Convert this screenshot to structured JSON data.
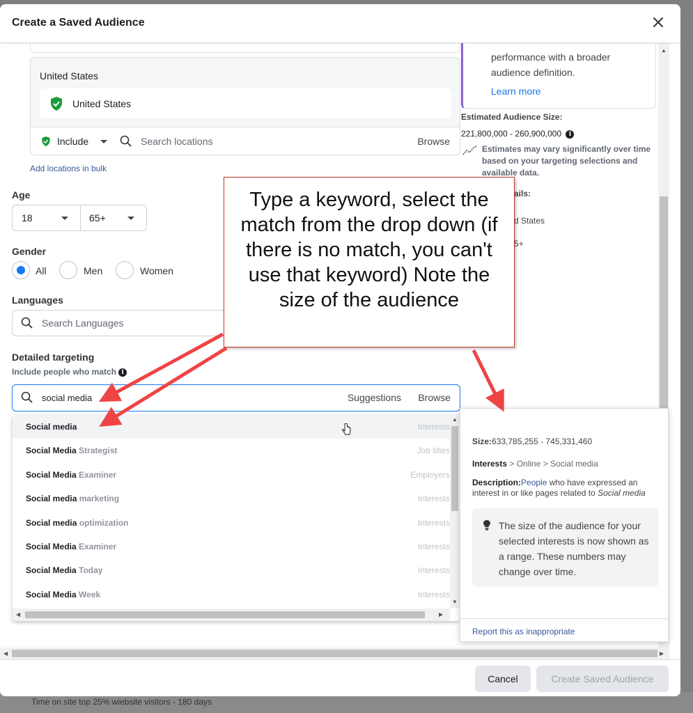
{
  "background": {
    "text": "Time on site top 25% wiebsite visitors - 180 days"
  },
  "modal": {
    "title": "Create a Saved Audience"
  },
  "locations": {
    "country": "United States",
    "chip": "United States",
    "include_label": "Include",
    "search_placeholder": "Search locations",
    "browse": "Browse",
    "bulk": "Add locations in bulk"
  },
  "age": {
    "label": "Age",
    "min": "18",
    "max": "65+"
  },
  "gender": {
    "label": "Gender",
    "options": [
      "All",
      "Men",
      "Women"
    ],
    "selected": "All"
  },
  "languages": {
    "label": "Languages",
    "placeholder": "Search Languages"
  },
  "detailed": {
    "label": "Detailed targeting",
    "sublabel": "Include people who match",
    "value": "social media",
    "suggestions": "Suggestions",
    "browse": "Browse",
    "results": [
      {
        "match": "Social media",
        "rest": "",
        "category": "Interests"
      },
      {
        "match": "Social Media",
        "rest": " Strategist",
        "category": "Job titles"
      },
      {
        "match": "Social Media",
        "rest": " Examiner",
        "category": "Employers"
      },
      {
        "match": "Social media",
        "rest": " marketing",
        "category": "Interests"
      },
      {
        "match": "Social media",
        "rest": " optimization",
        "category": "Interests"
      },
      {
        "match": "Social Media",
        "rest": " Examiner",
        "category": "Interests"
      },
      {
        "match": "Social Media",
        "rest": " Today",
        "category": "Interests"
      },
      {
        "match": "Social Media",
        "rest": " Week",
        "category": "Interests"
      }
    ]
  },
  "right_panel": {
    "info_text": "performance with a broader audience definition.",
    "learn_more": "Learn more",
    "est_label": "Estimated Audience Size:",
    "est_value": "221,800,000 - 260,900,000",
    "est_note": "Estimates may vary significantly over time based on your targeting selections and available data.",
    "partial_1": "ails:",
    "partial_2": "d States",
    "partial_3": "5+"
  },
  "popover": {
    "size_label": "Size:",
    "size_value": "633,785,255 - 745,331,460",
    "path_bold": "Interests",
    "path_rest": " > Online > Social media",
    "desc_label": "Description:",
    "desc_link": "People",
    "desc_text": " who have expressed an interest in or like pages related to ",
    "desc_italic": "Social media",
    "tip": "The size of the audience for your selected interests is now shown as a range. These numbers may change over time.",
    "report": "Report this as inappropriate"
  },
  "footer": {
    "cancel": "Cancel",
    "create": "Create Saved Audience"
  },
  "callout": {
    "text": "Type a keyword, select the match from the drop down (if there is no match, you can't use that keyword) Note the size of the audience"
  },
  "colors": {
    "accent": "#1877f2",
    "shield": "#1a9c3a",
    "callout_border": "#c0392b",
    "arrow": "#ef4444"
  }
}
